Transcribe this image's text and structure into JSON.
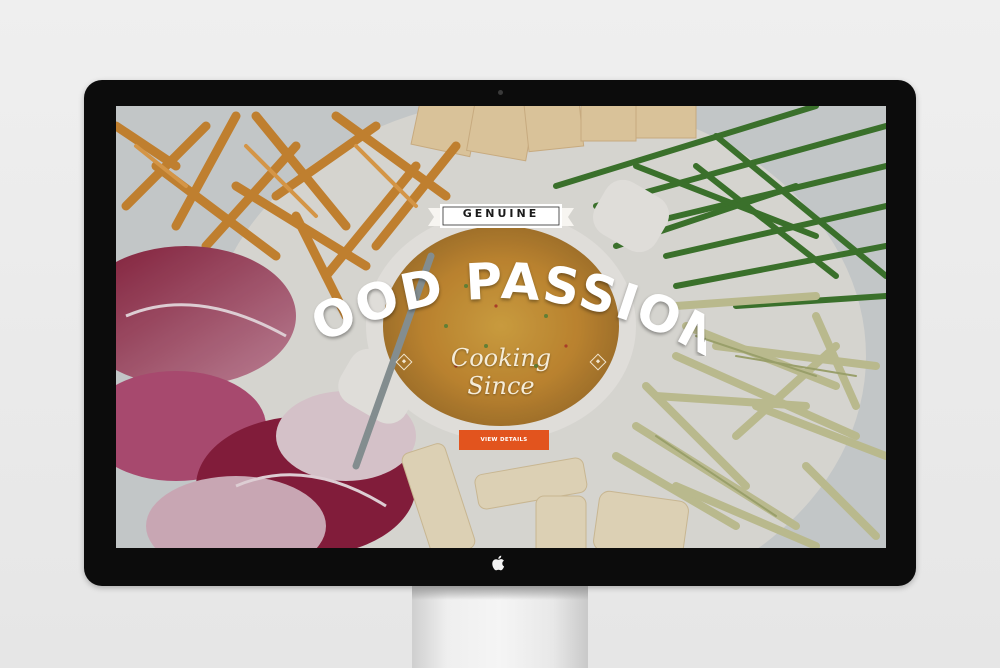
{
  "hero": {
    "badge": "GENUINE",
    "title": "FOOD PASSION",
    "subtitle": "Cooking Since",
    "cta_label": "VIEW DETAILS"
  },
  "colors": {
    "accent": "#e2541e",
    "bezel": "#0c0c0c",
    "title_text": "#ffffff",
    "subtitle_text": "#f5ecd8"
  },
  "icons": {
    "brand_logo": "apple-icon",
    "ornament": "diamond-icon"
  }
}
